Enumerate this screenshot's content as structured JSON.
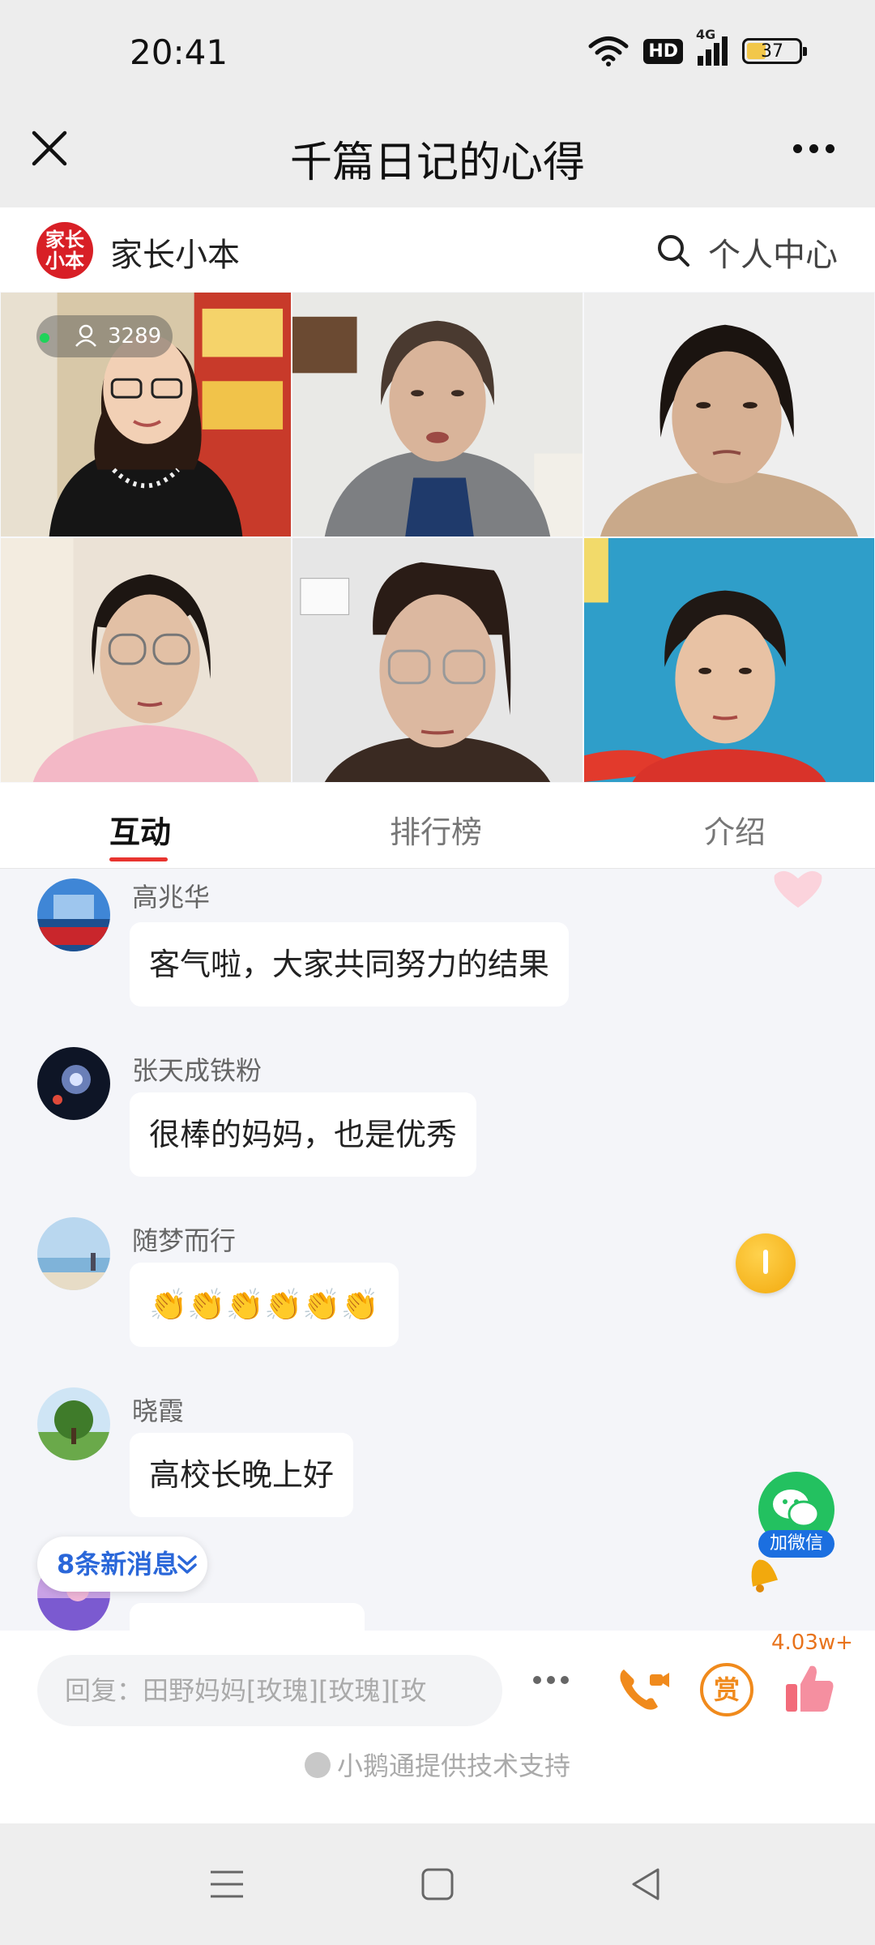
{
  "status_bar": {
    "time": "20:41",
    "hd": "HD",
    "network": "4G",
    "battery": "37",
    "battery_level_percent": 37
  },
  "header": {
    "title": "千篇日记的心得"
  },
  "channel": {
    "logo_text": "家长小本",
    "name": "家长小本",
    "profile_label": "个人中心"
  },
  "video": {
    "viewer_count": "3289"
  },
  "tabs": [
    {
      "label": "互动",
      "active": true
    },
    {
      "label": "排行榜",
      "active": false
    },
    {
      "label": "介绍",
      "active": false
    }
  ],
  "messages": [
    {
      "name": "高兆华",
      "text": "客气啦，大家共同努力的结果"
    },
    {
      "name": "张天成铁粉",
      "text": "很棒的妈妈，也是优秀"
    },
    {
      "name": "随梦而行",
      "text": "👏👏👏👏👏👏"
    },
    {
      "name": "晓霞",
      "text": "高校长晚上好"
    }
  ],
  "new_messages": {
    "label": "8条新消息"
  },
  "wechat": {
    "label": "加微信"
  },
  "input_bar": {
    "placeholder": "回复：田野妈妈[玫瑰][玫瑰][玫",
    "reward_label": "赏",
    "like_count": "4.03w+",
    "powered_by": "小鹅通提供技术支持"
  },
  "colors": {
    "accent_red": "#e8342f",
    "link_blue": "#2a67d9",
    "wechat_green": "#23c160",
    "orange": "#f08a1c"
  }
}
